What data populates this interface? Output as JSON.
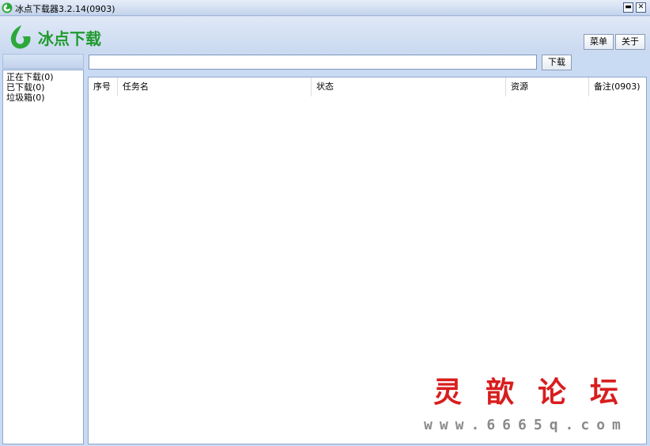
{
  "window": {
    "title": "冰点下载器3.2.14(0903)",
    "minimize_glyph": "▬",
    "close_glyph": "✕"
  },
  "header": {
    "logo_text": "冰点下载",
    "menu_label": "菜单",
    "about_label": "关于",
    "brand_color": "#1f9a2e"
  },
  "sidebar": {
    "items": [
      {
        "label": "正在下载(0)"
      },
      {
        "label": "已下载(0)"
      },
      {
        "label": "垃圾箱(0)"
      }
    ]
  },
  "search": {
    "value": "",
    "download_label": "下载"
  },
  "list": {
    "columns": [
      {
        "label": "序号"
      },
      {
        "label": "任务名"
      },
      {
        "label": "状态"
      },
      {
        "label": "资源"
      },
      {
        "label": "备注(0903)"
      }
    ],
    "rows": []
  },
  "watermark": {
    "chars": [
      "灵",
      "歆",
      "论",
      "坛"
    ],
    "url": "www.6665q.com"
  }
}
